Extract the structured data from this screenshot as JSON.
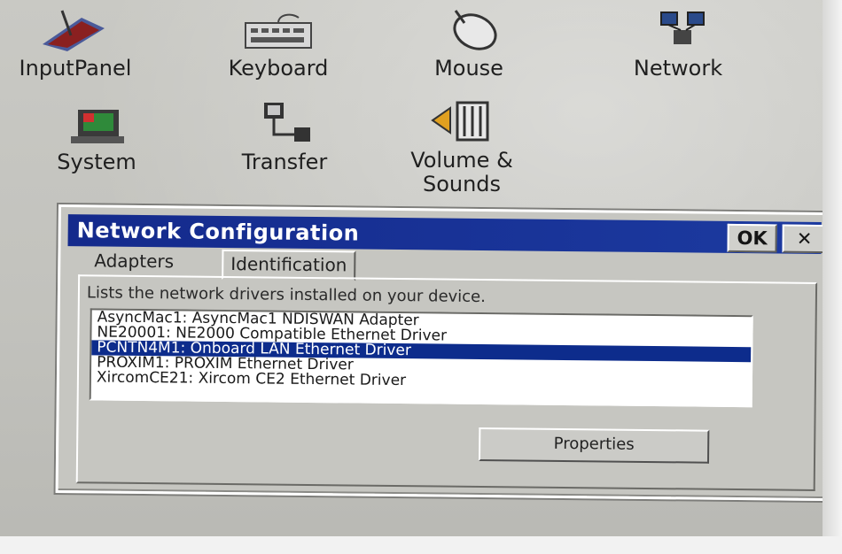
{
  "desktop": {
    "icons": [
      {
        "name": "InputPanel",
        "icon": "input-panel-icon"
      },
      {
        "name": "Keyboard",
        "icon": "keyboard-icon"
      },
      {
        "name": "Mouse",
        "icon": "mouse-icon"
      },
      {
        "name": "Network",
        "icon": "network-icon"
      },
      {
        "name": "System",
        "icon": "system-icon"
      },
      {
        "name": "Transfer",
        "icon": "transfer-icon"
      },
      {
        "name": "Volume &",
        "name2": "Sounds",
        "icon": "volume-icon"
      }
    ]
  },
  "dialog": {
    "title": "Network Configuration",
    "ok_label": "OK",
    "close_label": "✕",
    "tabs": [
      {
        "label": "Adapters",
        "active": true
      },
      {
        "label": "Identification",
        "active": false
      }
    ],
    "description": "Lists the network drivers installed on your device.",
    "adapters": [
      {
        "label": "AsyncMac1: AsyncMac1 NDISWAN Adapter",
        "selected": false
      },
      {
        "label": "NE20001: NE2000 Compatible Ethernet Driver",
        "selected": false
      },
      {
        "label": "PCNTN4M1: Onboard LAN Ethernet Driver",
        "selected": true
      },
      {
        "label": "PROXIM1: PROXIM Ethernet Driver",
        "selected": false
      },
      {
        "label": "XircomCE21: Xircom CE2 Ethernet Driver",
        "selected": false
      }
    ],
    "properties_label": "Properties"
  },
  "colors": {
    "titlebar": "#142a8c",
    "selection": "#0d2c8c",
    "dialog_face": "#c6c6c1"
  }
}
